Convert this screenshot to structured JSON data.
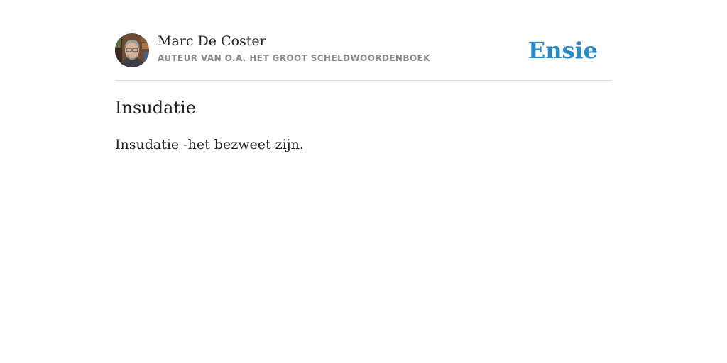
{
  "author": {
    "name": "Marc De Coster",
    "subtitle": "AUTEUR VAN O.A. HET GROOT SCHELDWOORDENBOEK",
    "avatar_icon": "author-portrait"
  },
  "brand": {
    "name": "Ensie",
    "color": "#2a8ac6"
  },
  "entry": {
    "title": "Insudatie",
    "definition": "Insudatie -het bezweet zijn."
  }
}
